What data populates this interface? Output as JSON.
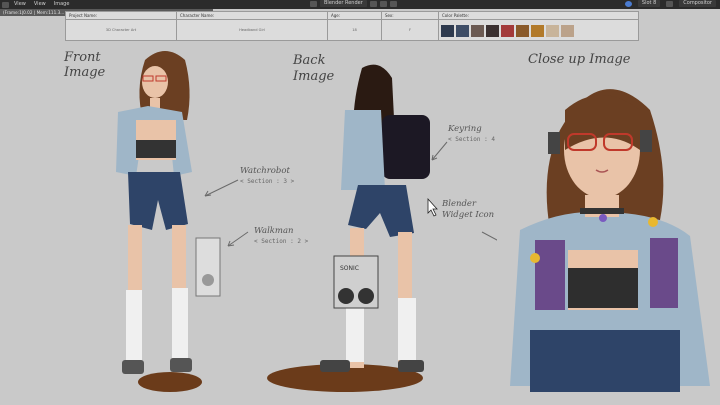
{
  "topbar": {
    "menu": [
      "View",
      "View",
      "Image"
    ],
    "window_title": "Blender Render",
    "scene": "Slot 8",
    "composite": "Compositor"
  },
  "infobar": "(Frame:1|0.02 | Mem:111.3...",
  "sheet": {
    "cols": [
      {
        "label": "Project Name:",
        "value": "3D Character Art"
      },
      {
        "label": "Character Name:",
        "value": "Headband Girl"
      },
      {
        "label": "Age:",
        "value": "18"
      },
      {
        "label": "Sex:",
        "value": "F"
      },
      {
        "label": "Color Palette:",
        "value": ""
      }
    ],
    "palette": [
      "#2e3a4e",
      "#3e4d66",
      "#6b5a52",
      "#3a3030",
      "#a33a3a",
      "#8a5a2a",
      "#b27a2a",
      "#c8b49a",
      "#bba28a"
    ]
  },
  "labels": {
    "front": "Front\nImage",
    "back": "Back\nImage",
    "closeup": "Close up Image",
    "watchrobot": "Watchrobot",
    "watchrobot_sec": "< Section : 3 >",
    "walkman": "Walkman",
    "walkman_sec": "< Section : 2 >",
    "keyring": "Keyring",
    "keyring_sec": "< Section : 4 >",
    "blender": "Blender\nWidget Icon",
    "walkman_brand": "SONIC"
  },
  "colors": {
    "bg": "#c9c9c9",
    "hair": "#6b3f22",
    "jacket": "#9fb6c8",
    "shorts": "#2e4468",
    "skin": "#e9c3a8",
    "board": "#6b3b1a"
  }
}
